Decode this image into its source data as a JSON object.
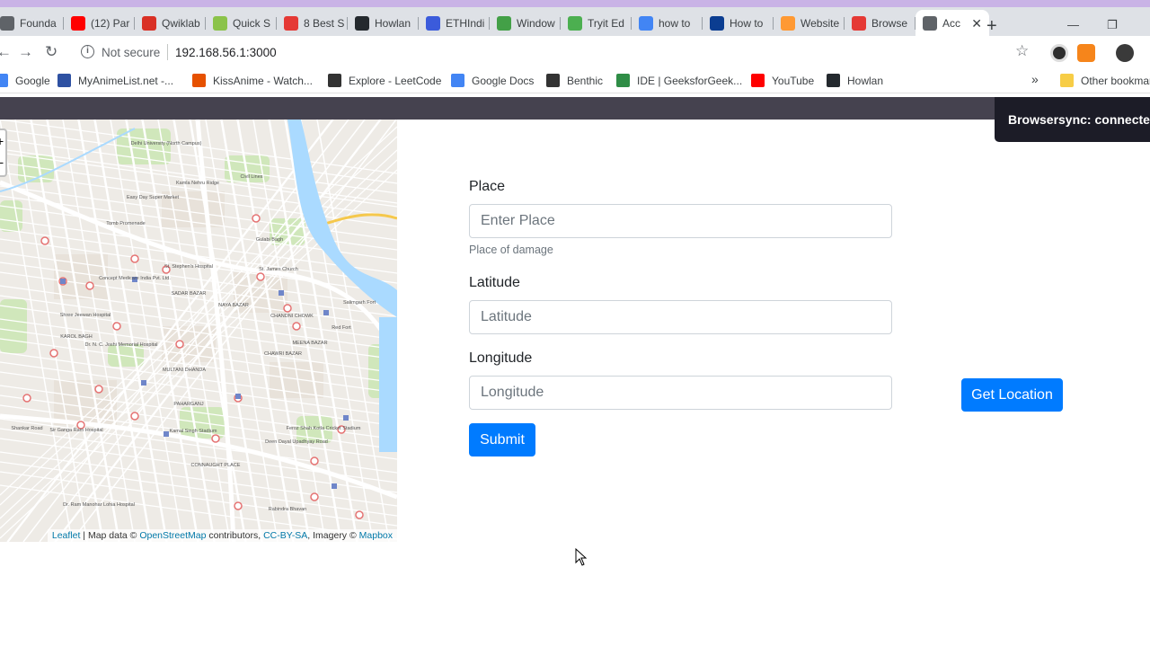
{
  "browser": {
    "tabs": [
      {
        "title": "Founda",
        "favicon": "globe-icon",
        "color": "#5f6368"
      },
      {
        "title": "(12) Par",
        "favicon": "youtube-icon",
        "color": "#ff0000"
      },
      {
        "title": "Qwiklab",
        "favicon": "gmail-icon",
        "color": "#d93025"
      },
      {
        "title": "Quick S",
        "favicon": "leaf-icon",
        "color": "#8bc34a"
      },
      {
        "title": "8 Best S",
        "favicon": "quora-icon",
        "color": "#e53935"
      },
      {
        "title": "Howlan",
        "favicon": "github-icon",
        "color": "#24292e"
      },
      {
        "title": "ETHIndi",
        "favicon": "eth-icon",
        "color": "#3b5bdb"
      },
      {
        "title": "Window",
        "favicon": "sheet-icon",
        "color": "#43a047"
      },
      {
        "title": "Tryit Ed",
        "favicon": "w3-icon",
        "color": "#4caf50"
      },
      {
        "title": "how to",
        "favicon": "google-icon",
        "color": "#4285f4"
      },
      {
        "title": "How to",
        "favicon": "site-icon",
        "color": "#0b3d91"
      },
      {
        "title": "Website",
        "favicon": "india-flag-icon",
        "color": "#ff9933"
      },
      {
        "title": "Browse",
        "favicon": "browsersync-icon",
        "color": "#e53935"
      },
      {
        "title": "Acc",
        "favicon": "globe-icon",
        "color": "#5f6368"
      }
    ],
    "active_tab_index": 13,
    "close_tab_glyph": "✕",
    "new_tab_glyph": "+",
    "window_controls": [
      "—",
      "❐"
    ],
    "security_text": "Not secure",
    "url": "192.168.56.1:3000",
    "bookmarks": [
      {
        "label": "Google",
        "icon": "google-icon",
        "color": "#4285f4"
      },
      {
        "label": "MyAnimeList.net -...",
        "icon": "mal-icon",
        "color": "#2e51a2"
      },
      {
        "label": "KissAnime - Watch...",
        "icon": "kissanime-icon",
        "color": "#e65100"
      },
      {
        "label": "Explore - LeetCode",
        "icon": "leetcode-icon",
        "color": "#333333"
      },
      {
        "label": "Google Docs",
        "icon": "docs-icon",
        "color": "#4285f4"
      },
      {
        "label": "Benthic",
        "icon": "benthic-icon",
        "color": "#333333"
      },
      {
        "label": "IDE | GeeksforGeek...",
        "icon": "gfg-icon",
        "color": "#2f8d46"
      },
      {
        "label": "YouTube",
        "icon": "youtube-icon",
        "color": "#ff0000"
      },
      {
        "label": "Howlan",
        "icon": "github-icon",
        "color": "#24292e"
      }
    ],
    "overflow_glyph": "»",
    "other_bookmarks": "Other bookmar"
  },
  "page": {
    "browsersync": "Browsersync: connected",
    "map": {
      "zoom_in": "+",
      "zoom_out": "−",
      "attribution": {
        "leaflet": "Leaflet",
        "text1": " | Map data © ",
        "osm": "OpenStreetMap",
        "text2": " contributors, ",
        "license": "CC-BY-SA",
        "text3": ", Imagery © ",
        "imagery": "Mapbox"
      },
      "places": [
        "Gulabi Bagh",
        "Delhi University (North Campus)",
        "Kamla Nehru Ridge",
        "Civil Lines",
        "Easy Day Super Market",
        "Tomb Promenade",
        "St. Stephen's Hospital",
        "St. James Church",
        "Concept Medicare India Pvt. Ltd.",
        "SADAR BAZAR",
        "NAYA BAZAR",
        "CHANDNI CHOWK",
        "Salimgarh Fort",
        "Red Fort",
        "Shree Jeewan Hospital",
        "KAROL BAGH",
        "Dr. N. C. Joshi Memorial Hospital",
        "MEENA BAZAR",
        "CHAWRI BAZAR",
        "MULTANI DHANDA",
        "PAHARGANJ",
        "Sir Ganga Ram Hospital",
        "Kamal Singh Stadium",
        "Feroz Shah Kotla Cricket Stadium",
        "CONNAUGHT PLACE",
        "Dr. Ram Manohar Lohia Hospital",
        "Rabindra Bhavan",
        "Deen Dayal Upadhyay Road",
        "Shankar Road"
      ]
    },
    "form": {
      "place_label": "Place",
      "place_placeholder": "Enter Place",
      "place_help": "Place of damage",
      "latitude_label": "Latitude",
      "latitude_placeholder": "Latitude",
      "longitude_label": "Longitude",
      "longitude_placeholder": "Longitude",
      "submit": "Submit",
      "get_location": "Get Location"
    },
    "colors": {
      "primary": "#007bff",
      "navbar": "#45424f",
      "toast": "#1c1c27",
      "river": "#aadaff"
    }
  }
}
